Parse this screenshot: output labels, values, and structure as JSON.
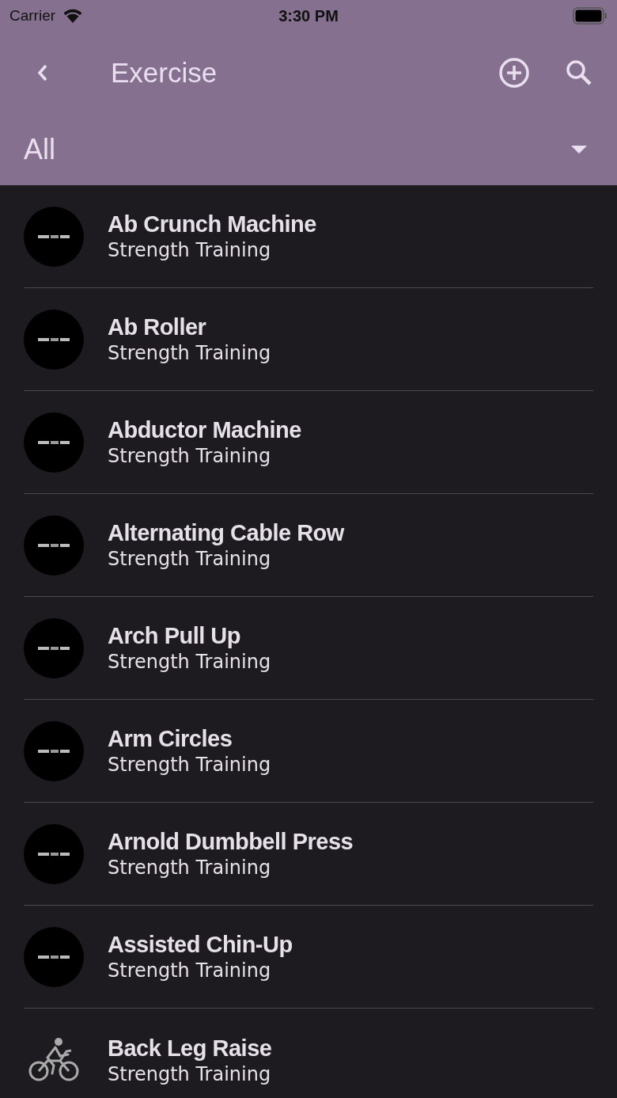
{
  "status_bar": {
    "carrier": "Carrier",
    "time": "3:30 PM"
  },
  "app_bar": {
    "title": "Exercise"
  },
  "filter": {
    "value": "All"
  },
  "exercises": [
    {
      "name": "Ab Crunch Machine",
      "category": "Strength Training",
      "kind": "picture"
    },
    {
      "name": "Ab Roller",
      "category": "Strength Training",
      "kind": "picture"
    },
    {
      "name": "Abductor Machine",
      "category": "Strength Training",
      "kind": "picture"
    },
    {
      "name": "Alternating Cable Row",
      "category": "Strength Training",
      "kind": "picture"
    },
    {
      "name": "Arch Pull Up",
      "category": "Strength Training",
      "kind": "picture"
    },
    {
      "name": "Arm Circles",
      "category": "Strength Training",
      "kind": "picture"
    },
    {
      "name": "Arnold Dumbbell Press",
      "category": "Strength Training",
      "kind": "picture"
    },
    {
      "name": "Assisted Chin-Up",
      "category": "Strength Training",
      "kind": "picture"
    },
    {
      "name": "Back Leg Raise",
      "category": "Strength Training",
      "kind": "cycling"
    }
  ]
}
